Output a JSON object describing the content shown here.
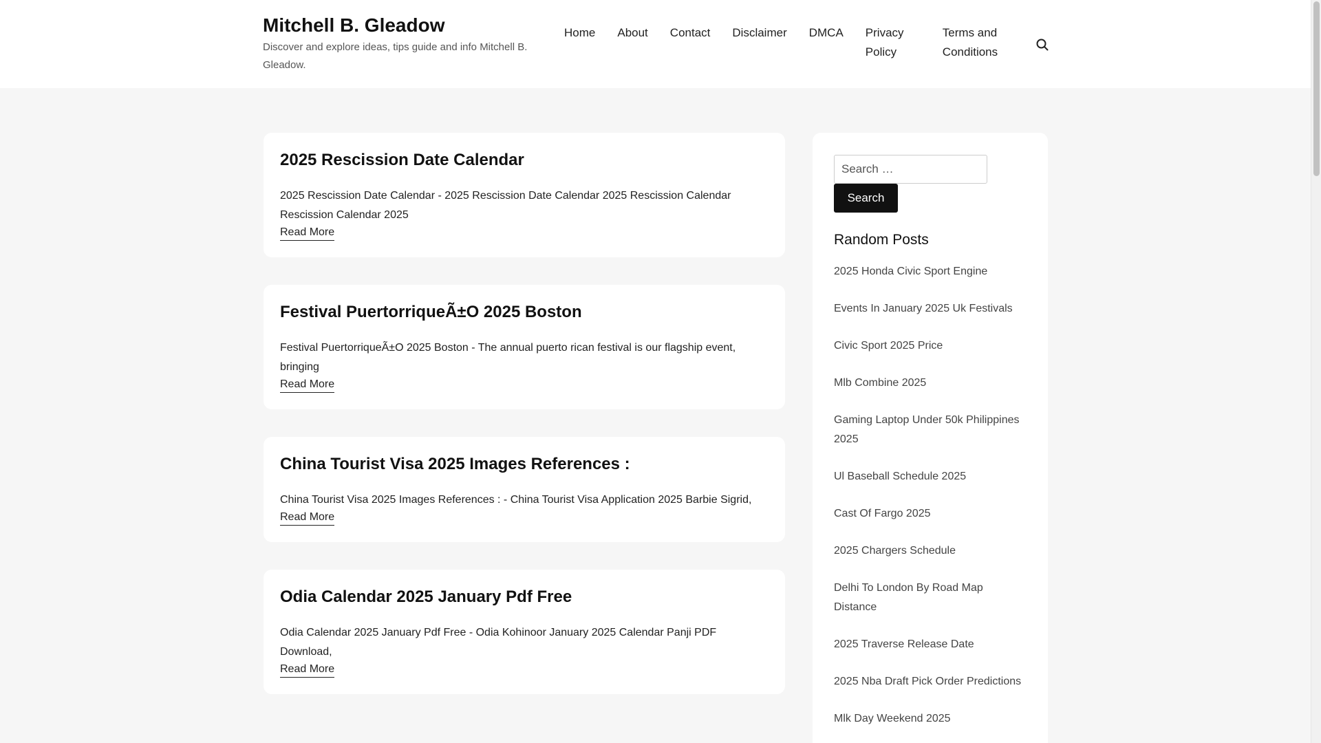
{
  "site": {
    "title": "Mitchell B. Gleadow",
    "description": "Discover and explore ideas, tips guide and info Mitchell B. Gleadow."
  },
  "nav": {
    "items": [
      "Home",
      "About",
      "Contact",
      "Disclaimer",
      "DMCA",
      "Privacy Policy",
      "Terms and Conditions"
    ]
  },
  "header_icons": {
    "search_toggle": "search-icon"
  },
  "posts": [
    {
      "title": "2025 Rescission Date Calendar",
      "excerpt": "2025 Rescission Date Calendar - 2025 Rescission Date Calendar 2025 Rescission Calendar Rescission Calendar 2025",
      "read_more": "Read More"
    },
    {
      "title": "Festival PuertorriqueÃ±O 2025 Boston",
      "excerpt": "Festival PuertorriqueÃ±O 2025 Boston - The annual puerto rican festival is our flagship event, bringing",
      "read_more": "Read More"
    },
    {
      "title": "China Tourist Visa 2025 Images References :",
      "excerpt": "China Tourist Visa 2025 Images References : - China Tourist Visa Application 2025 Barbie Sigrid,",
      "read_more": "Read More"
    },
    {
      "title": "Odia Calendar 2025 January Pdf Free",
      "excerpt": "Odia Calendar 2025 January Pdf Free - Odia Kohinoor January 2025 Calendar Panji PDF Download,",
      "read_more": "Read More"
    }
  ],
  "sidebar": {
    "search": {
      "placeholder": "Search …",
      "button": "Search"
    },
    "random_posts": {
      "title": "Random Posts",
      "items": [
        "2025 Honda Civic Sport Engine",
        "Events In January 2025 Uk Festivals",
        "Civic Sport 2025 Price",
        "Mlb Combine 2025",
        "Gaming Laptop Under 50k Philippines 2025",
        "Ul Baseball Schedule 2025",
        "Cast Of Fargo 2025",
        "2025 Chargers Schedule",
        "Delhi To London By Road Map Distance",
        "2025 Traverse Release Date",
        "2025 Nba Draft Pick Order Predictions",
        "Mlk Day Weekend 2025"
      ]
    }
  }
}
